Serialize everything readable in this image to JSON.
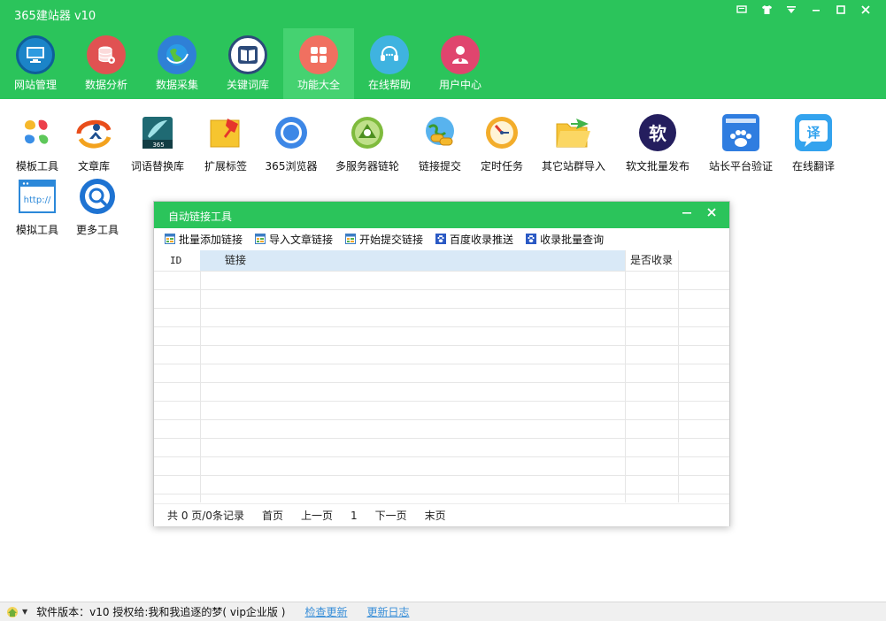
{
  "app": {
    "title": "365建站器 v10"
  },
  "window_controls": {
    "message": "▣",
    "skin": "👕",
    "menu": "▼",
    "minimize": "—",
    "maximize": "□",
    "close": "✕"
  },
  "nav": [
    {
      "label": "网站管理",
      "icon": "monitor-icon",
      "color": "#1b84c8"
    },
    {
      "label": "数据分析",
      "icon": "database-icon",
      "color": "#e05252"
    },
    {
      "label": "数据采集",
      "icon": "globe-icon",
      "color": "#2f80d6"
    },
    {
      "label": "关键词库",
      "icon": "book-icon",
      "color": "#2c4a7a"
    },
    {
      "label": "功能大全",
      "icon": "grid-icon",
      "color": "#f07060",
      "active": true
    },
    {
      "label": "在线帮助",
      "icon": "headset-icon",
      "color": "#3fb3e0"
    },
    {
      "label": "用户中心",
      "icon": "user-icon",
      "color": "#e0456e"
    }
  ],
  "tools": [
    {
      "label": "模板工具",
      "icon": "template-icon"
    },
    {
      "label": "文章库",
      "icon": "article-icon"
    },
    {
      "label": "词语替换库",
      "icon": "replace-icon"
    },
    {
      "label": "扩展标签",
      "icon": "tag-icon"
    },
    {
      "label": "365浏览器",
      "icon": "browser-icon"
    },
    {
      "label": "多服务器链轮",
      "icon": "server-icon"
    },
    {
      "label": "链接提交",
      "icon": "link-submit-icon"
    },
    {
      "label": "定时任务",
      "icon": "timer-icon"
    },
    {
      "label": "其它站群导入",
      "icon": "folder-icon"
    },
    {
      "label": "软文批量发布",
      "icon": "soft-article-icon",
      "glyph": "软"
    },
    {
      "label": "站长平台验证",
      "icon": "baidu-platform-icon"
    },
    {
      "label": "在线翻译",
      "icon": "translate-icon",
      "glyph": "译"
    },
    {
      "label": "模拟工具",
      "icon": "http-icon",
      "glyph": "http://"
    },
    {
      "label": "更多工具",
      "icon": "more-tools-icon"
    }
  ],
  "dialog": {
    "title": "自动链接工具",
    "minimize": "—",
    "close": "✕",
    "toolbar": [
      {
        "label": "批量添加链接",
        "icon": "table-icon"
      },
      {
        "label": "导入文章链接",
        "icon": "table-icon"
      },
      {
        "label": "开始提交链接",
        "icon": "table-icon"
      },
      {
        "label": "百度收录推送",
        "icon": "paw-icon"
      },
      {
        "label": "收录批量查询",
        "icon": "paw-icon"
      }
    ],
    "columns": {
      "id": "ID",
      "link": "链接",
      "indexed": "是否收录"
    },
    "pager": {
      "summary": "共 0 页/0条记录",
      "first": "首页",
      "prev": "上一页",
      "current": "1",
      "next": "下一页",
      "last": "末页"
    }
  },
  "statusbar": {
    "version_text": "软件版本：v10  授权给:我和我追逐的梦( vip企业版 )",
    "check_update": "检查更新",
    "changelog": "更新日志"
  }
}
